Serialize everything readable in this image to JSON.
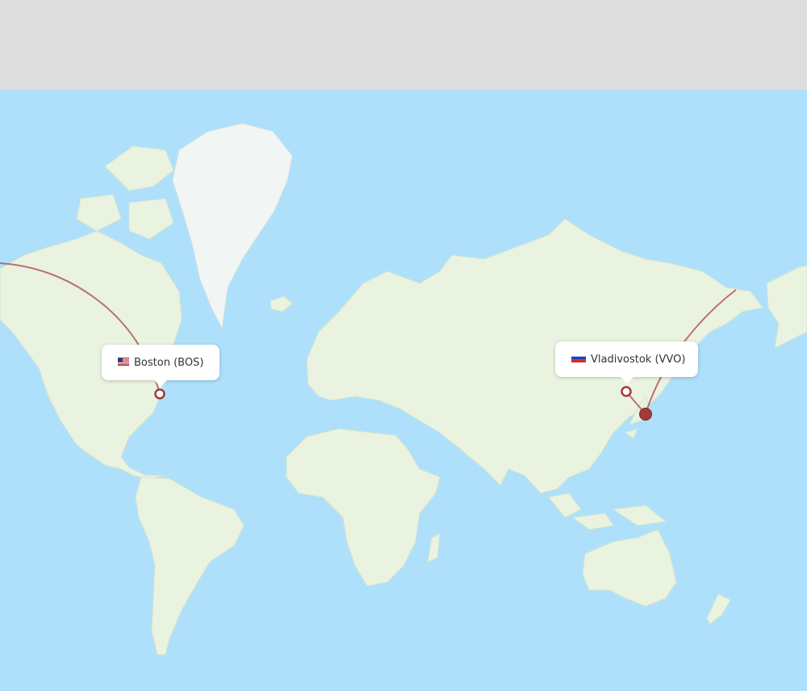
{
  "origin": {
    "city": "Boston",
    "code": "BOS",
    "label": "Boston (BOS)",
    "flag": "us-flag-icon"
  },
  "destination": {
    "city": "Vladivostok",
    "code": "VVO",
    "label": "Vladivostok (VVO)",
    "flag": "ru-flag-icon"
  },
  "colors": {
    "ocean": "#aee0fb",
    "land": "#eaf3e0",
    "ice": "#f1f6f4",
    "route": "#b25a5a",
    "marker": "#a33a3a",
    "top_band": "#dedede"
  }
}
